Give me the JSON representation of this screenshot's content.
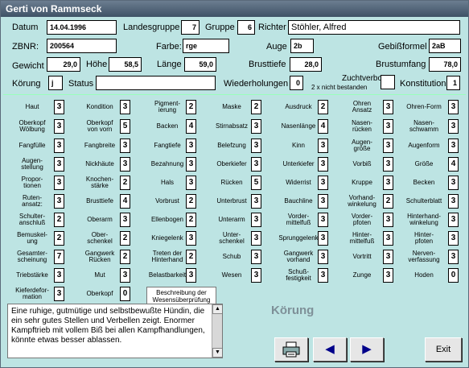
{
  "window": {
    "title": "Gerti von Rammseck"
  },
  "header": {
    "datum_label": "Datum",
    "datum": "14.04.1996",
    "landesgruppe_label": "Landesgruppe",
    "landesgruppe": "7",
    "gruppe_label": "Gruppe",
    "gruppe": "6",
    "richter_label": "Richter",
    "richter": "Stöhler, Alfred",
    "zbnr_label": "ZBNR:",
    "zbnr": "200564",
    "farbe_label": "Farbe:",
    "farbe": "rge",
    "auge_label": "Auge",
    "auge": "2b",
    "gebiss_label": "Gebißformel",
    "gebiss": "2aB",
    "gewicht_label": "Gewicht",
    "gewicht": "29,0",
    "hoehe_label": "Höhe",
    "hoehe": "58,5",
    "laenge_label": "Länge",
    "laenge": "59,0",
    "brusttiefe_label": "Brusttiefe",
    "brusttiefe": "28,0",
    "brustumfang_label": "Brustumfang",
    "brustumfang": "78,0",
    "koerung_label": "Körung",
    "koerung": "j",
    "status_label": "Status",
    "status": "",
    "wiederholungen_label": "Wiederholungen",
    "wiederholungen": "0",
    "zuchtverbot_label": "Zuchtverbot",
    "zuchtverbot_note": "2 x nicht bestanden",
    "zuchtverbot": "",
    "konstitution_label": "Konstitution",
    "konstitution": "1"
  },
  "grid": [
    [
      {
        "l": "Haut",
        "v": "3"
      },
      {
        "l": "Kondition",
        "v": "3"
      },
      {
        "l": "Pigment-\nierung",
        "v": "2"
      },
      {
        "l": "Maske",
        "v": "2"
      },
      {
        "l": "Ausdruck",
        "v": "2"
      },
      {
        "l": "Ohren\nAnsatz",
        "v": "3"
      },
      {
        "l": "Ohren-Form",
        "v": "3"
      }
    ],
    [
      {
        "l": "Oberkopf\nWölbung",
        "v": "3"
      },
      {
        "l": "Oberkopf\nvon vorn",
        "v": "5"
      },
      {
        "l": "Backen",
        "v": "4"
      },
      {
        "l": "Stirnabsatz",
        "v": "3"
      },
      {
        "l": "Nasenlänge",
        "v": "4"
      },
      {
        "l": "Nasen-\nrücken",
        "v": "3"
      },
      {
        "l": "Nasen-\nschwamm",
        "v": "3"
      }
    ],
    [
      {
        "l": "Fangfülle",
        "v": "3"
      },
      {
        "l": "Fangbreite",
        "v": "3"
      },
      {
        "l": "Fangtiefe",
        "v": "3"
      },
      {
        "l": "Belefzung",
        "v": "3"
      },
      {
        "l": "Kinn",
        "v": "3"
      },
      {
        "l": "Augen-\ngröße",
        "v": "3"
      },
      {
        "l": "Augenform",
        "v": "3"
      }
    ],
    [
      {
        "l": "Augen-\nstellung",
        "v": "3"
      },
      {
        "l": "Nickhäute",
        "v": "3"
      },
      {
        "l": "Bezahnung",
        "v": "3"
      },
      {
        "l": "Oberkiefer",
        "v": "3"
      },
      {
        "l": "Unterkiefer",
        "v": "3"
      },
      {
        "l": "Vorbiß",
        "v": "3"
      },
      {
        "l": "Größe",
        "v": "4"
      }
    ],
    [
      {
        "l": "Propor-\ntionen",
        "v": "3"
      },
      {
        "l": "Knochen-\nstärke",
        "v": "2"
      },
      {
        "l": "Hals",
        "v": "3"
      },
      {
        "l": "Rücken",
        "v": "5"
      },
      {
        "l": "Widerrist",
        "v": "3"
      },
      {
        "l": "Kruppe",
        "v": "3"
      },
      {
        "l": "Becken",
        "v": "3"
      }
    ],
    [
      {
        "l": "Ruten-\nansatz:",
        "v": "3"
      },
      {
        "l": "Brusttiefe",
        "v": "4"
      },
      {
        "l": "Vorbrust",
        "v": "2"
      },
      {
        "l": "Unterbrust",
        "v": "3"
      },
      {
        "l": "Bauchline",
        "v": "3"
      },
      {
        "l": "Vorhand-\nwinkelung",
        "v": "2"
      },
      {
        "l": "Schulterblatt",
        "v": "3"
      }
    ],
    [
      {
        "l": "Schulter-\nanschluß",
        "v": "2"
      },
      {
        "l": "Oberarm",
        "v": "3"
      },
      {
        "l": "Ellenbogen",
        "v": "2"
      },
      {
        "l": "Unterarm",
        "v": "3"
      },
      {
        "l": "Vorder-\nmittelfuß",
        "v": "3"
      },
      {
        "l": "Vorder-\npfoten",
        "v": "3"
      },
      {
        "l": "Hinterhand-\nwinkelung",
        "v": "3"
      }
    ],
    [
      {
        "l": "Bemuskel-\nung",
        "v": "2"
      },
      {
        "l": "Ober-\nschenkel",
        "v": "2"
      },
      {
        "l": "Kniegelenk",
        "v": "3"
      },
      {
        "l": "Unter-\nschenkel",
        "v": "3"
      },
      {
        "l": "Sprunggelenk",
        "v": "3"
      },
      {
        "l": "Hinter-\nmittelfuß",
        "v": "3"
      },
      {
        "l": "Hinter-\npfoten",
        "v": "3"
      }
    ],
    [
      {
        "l": "Gesamter-\nscheinung",
        "v": "7"
      },
      {
        "l": "Gangwerk\nRücken",
        "v": "2"
      },
      {
        "l": "Treten der\nHinterhand",
        "v": "2"
      },
      {
        "l": "Schub",
        "v": "3"
      },
      {
        "l": "Gangwerk\nvorhand",
        "v": "3"
      },
      {
        "l": "Vortritt",
        "v": "3"
      },
      {
        "l": "Nerven-\nverfassung",
        "v": "3"
      }
    ],
    [
      {
        "l": "Triebstärke",
        "v": "3"
      },
      {
        "l": "Mut",
        "v": "3"
      },
      {
        "l": "Belastbarkeit",
        "v": "3"
      },
      {
        "l": "Wesen",
        "v": "3"
      },
      {
        "l": "Schuß-\nfestigkeit",
        "v": "3"
      },
      {
        "l": "Zunge",
        "v": "3"
      },
      {
        "l": "Hoden",
        "v": "0"
      }
    ],
    [
      {
        "l": "Kieferdefor-\nmation",
        "v": "3"
      },
      {
        "l": "Oberkopf",
        "v": "0"
      }
    ]
  ],
  "wesen": {
    "tab_label": "Beschreibung der Wesensüberprüfung",
    "text": "Eine ruhige, gutmütige und selbstbewußte Hündin, die ein sehr gutes Stellen und Verbellen zeigt. Enormer Kampftrieb mit vollem Biß bei allen Kampfhandlungen, könnte etwas besser ablassen."
  },
  "koerung_heading": "Körung",
  "buttons": {
    "exit": "Exit",
    "print_icon": "printer-icon",
    "prev_icon": "arrow-left-icon",
    "next_icon": "arrow-right-icon"
  }
}
